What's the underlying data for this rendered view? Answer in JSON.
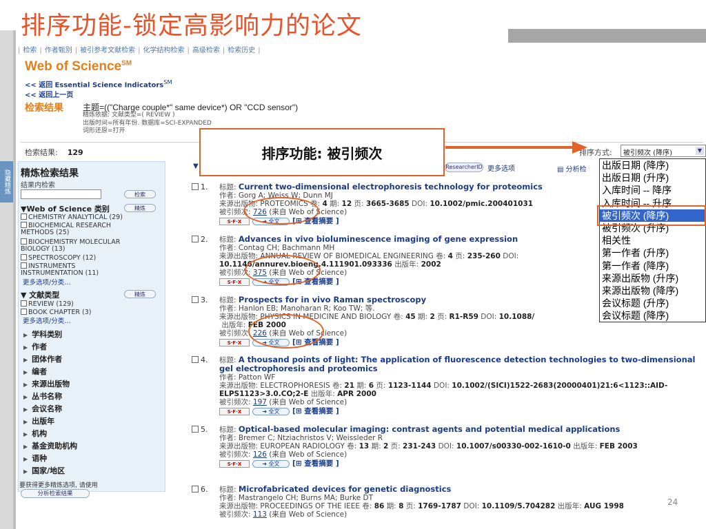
{
  "slide": {
    "title": "排序功能-锁定高影响力的论文",
    "callout": "排序功能: 被引频次",
    "page_number": "24"
  },
  "nav": {
    "items": [
      "检索",
      "作者甄别",
      "被引参考文献检索",
      "化学结构检索",
      "高级检索",
      "检索历史"
    ]
  },
  "app": {
    "logo": "Web of Science",
    "logo_sup": "SM",
    "back_link_label": "<< 返回",
    "back_link_target": "Essential Science Indicators",
    "back_link_sup": "SM",
    "back_up_label": "<< 返回上一页"
  },
  "search": {
    "label": "检索结果",
    "query": "主题=((\"Charge couple*\" same device*) OR \"CCD sensor\")",
    "refine_line1": "精炼依据: 文献类型=( REVIEW )",
    "refine_line2": "出版时间=所有年份. 数据库=SCI-EXPANDED",
    "refine_line3": "词形还原=打开"
  },
  "results": {
    "count_label": "检索结果:",
    "count": "129"
  },
  "sort": {
    "label": "排序方式:",
    "selected": "被引频次 (降序)",
    "options": [
      "出版日期 (降序)",
      "出版日期 (升序)",
      "入库时间 -- 降序",
      "入库时间 -- 升序",
      "被引频次 (降序)",
      "被引频次 (升序)",
      "相关性",
      "第一作者 (升序)",
      "第一作者 (降序)",
      "来源出版物 (升序)",
      "来源出版物 (降序)",
      "会议标题 (升序)",
      "会议标题 (降序)"
    ]
  },
  "toolbar": {
    "researcher_id": "ResearcherID",
    "more_options": "更多选项",
    "analyze": "分析检"
  },
  "sidebar": {
    "tab_label": "隐藏精炼",
    "title": "精炼检索结果",
    "within_label": "结果内检索",
    "search_button": "检索",
    "refine_button": "精炼",
    "wos_category": "Web of Science 类别",
    "categories": [
      "CHEMISTRY ANALYTICAL (29)",
      "BIOCHEMICAL RESEARCH METHODS (25)",
      "BIOCHEMISTRY MOLECULAR BIOLOGY (13)",
      "SPECTROSCOPY (12)",
      "INSTRUMENTS INSTRUMENTATION (11)"
    ],
    "more1": "更多选项/分类…",
    "doc_type": "文献类型",
    "doc_types": [
      "REVIEW (129)",
      "BOOK CHAPTER (3)"
    ],
    "more2": "更多选项/分类…",
    "nav_items": [
      "学科类别",
      "作者",
      "团体作者",
      "编者",
      "来源出版物",
      "丛书名称",
      "会议名称",
      "出版年",
      "机构",
      "基金资助机构",
      "语种",
      "国家/地区"
    ],
    "footer_text": "要获得更多精炼选项, 请使用",
    "footer_button": "分析检索结果"
  },
  "labels": {
    "title": "标题:",
    "author": "作者:",
    "source": "来源出版物:",
    "cited": "被引频次:",
    "cited_src": "(来自 Web of Science)",
    "volume": "卷:",
    "issue": "期:",
    "pages": "页:",
    "doi": "DOI:",
    "pubyear": "出版年:",
    "sfx": "S·F·X",
    "fulltext": "➜ 全文",
    "abstract": "[⊞ 查看摘要 ]"
  },
  "records": [
    {
      "num": "1.",
      "title": "Current two-dimensional electrophoresis technology for proteomics",
      "authors": "Gorg A; Weiss W; Dunn MJ",
      "source": "PROTEOMICS",
      "volume": "4",
      "issue": "12",
      "pages": "3665-3685",
      "doi": "10.1002/pmic.200401031",
      "pubyear": "",
      "cited": "726"
    },
    {
      "num": "2.",
      "title": "Advances in vivo bioluminescence imaging of gene expression",
      "authors": "Contag CH; Bachmann MH",
      "source": "ANNUAL REVIEW OF BIOMEDICAL ENGINEERING",
      "volume": "4",
      "issue": "",
      "pages": "235-260",
      "doi": "10.1146/annurev.bioeng.4.111901.093336",
      "pubyear": "2002",
      "cited": "375"
    },
    {
      "num": "3.",
      "title": "Prospects for in vivo Raman spectroscopy",
      "authors": "Hanlon EB; Manoharan R; Koo TW; 等.",
      "source": "PHYSICS IN MEDICINE AND BIOLOGY",
      "volume": "45",
      "issue": "2",
      "pages": "R1-R59",
      "doi": "10.1088/",
      "pubyear": "FEB 2000",
      "cited": "226"
    },
    {
      "num": "4.",
      "title": "A thousand points of light: The application of fluorescence detection technologies to two-dimensional gel electrophoresis and proteomics",
      "authors": "Patton WF",
      "source": "ELECTROPHORESIS",
      "volume": "21",
      "issue": "6",
      "pages": "1123-1144",
      "doi": "10.1002/(SICI)1522-2683(20000401)21:6<1123::AID-ELPS1123>3.0.CO;2-E",
      "pubyear": "APR 2000",
      "cited": "197"
    },
    {
      "num": "5.",
      "title": "Optical-based molecular imaging: contrast agents and potential medical applications",
      "authors": "Bremer C; Ntziachristos V; Weissleder R",
      "source": "EUROPEAN RADIOLOGY",
      "volume": "13",
      "issue": "2",
      "pages": "231-243",
      "doi": "10.1007/s00330-002-1610-0",
      "pubyear": "FEB 2003",
      "cited": "126"
    },
    {
      "num": "6.",
      "title": "Microfabricated devices for genetic diagnostics",
      "authors": "Mastrangelo CH; Burns MA; Burke DT",
      "source": "PROCEEDINGS OF THE IEEE",
      "volume": "86",
      "issue": "8",
      "pages": "1769-1787",
      "doi": "10.1109/5.704282",
      "pubyear": "AUG 1998",
      "cited": "113"
    }
  ],
  "colors": {
    "title": "#e8532a",
    "accent": "#e0642a",
    "logo": "#e0801f",
    "link": "#1a3b8a",
    "selected_option": "#3366cc"
  }
}
